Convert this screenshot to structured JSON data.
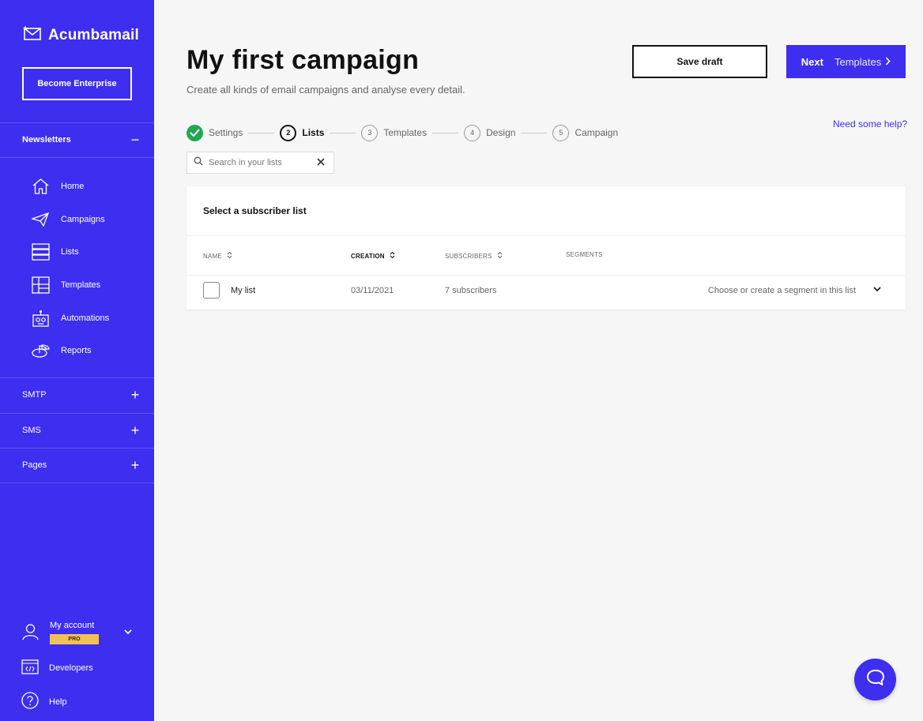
{
  "sidebar": {
    "logo_text": "Acumbamail",
    "enterprise_label": "Become Enterprise",
    "newsletters_label": "Newsletters",
    "nav": [
      {
        "label": "Home",
        "icon": "home-icon"
      },
      {
        "label": "Campaigns",
        "icon": "paper-plane-icon"
      },
      {
        "label": "Lists",
        "icon": "list-icon"
      },
      {
        "label": "Templates",
        "icon": "templates-icon"
      },
      {
        "label": "Automations",
        "icon": "robot-icon"
      },
      {
        "label": "Reports",
        "icon": "pie-chart-icon"
      }
    ],
    "sections": [
      {
        "label": "SMTP"
      },
      {
        "label": "SMS"
      },
      {
        "label": "Pages"
      }
    ],
    "account_label": "My account",
    "pro_badge": "PRO",
    "developers_label": "Developers",
    "help_label": "Help"
  },
  "header": {
    "title": "My first campaign",
    "subtitle": "Create all kinds of email campaigns and analyse every detail.",
    "save_label": "Save draft",
    "next_label": "Next",
    "next_target": "Templates",
    "help_link": "Need some help?"
  },
  "steps": [
    {
      "num": "1",
      "label": "Settings",
      "state": "done"
    },
    {
      "num": "2",
      "label": "Lists",
      "state": "active"
    },
    {
      "num": "3",
      "label": "Templates",
      "state": "todo"
    },
    {
      "num": "4",
      "label": "Design",
      "state": "todo"
    },
    {
      "num": "5",
      "label": "Campaign",
      "state": "todo"
    }
  ],
  "search": {
    "placeholder": "Search in your lists"
  },
  "table": {
    "title": "Select a subscriber list",
    "columns": {
      "name": "NAME",
      "creation": "CREATION",
      "subscribers": "SUBSCRIBERS",
      "segments": "SEGMENTS"
    },
    "rows": [
      {
        "name": "My list",
        "creation": "03/11/2021",
        "subscribers": "7 subscribers",
        "segments": "Choose or create a segment in this list"
      }
    ]
  },
  "colors": {
    "primary": "#3d2ef0",
    "success": "#1fa855",
    "pro": "#f2c155"
  }
}
